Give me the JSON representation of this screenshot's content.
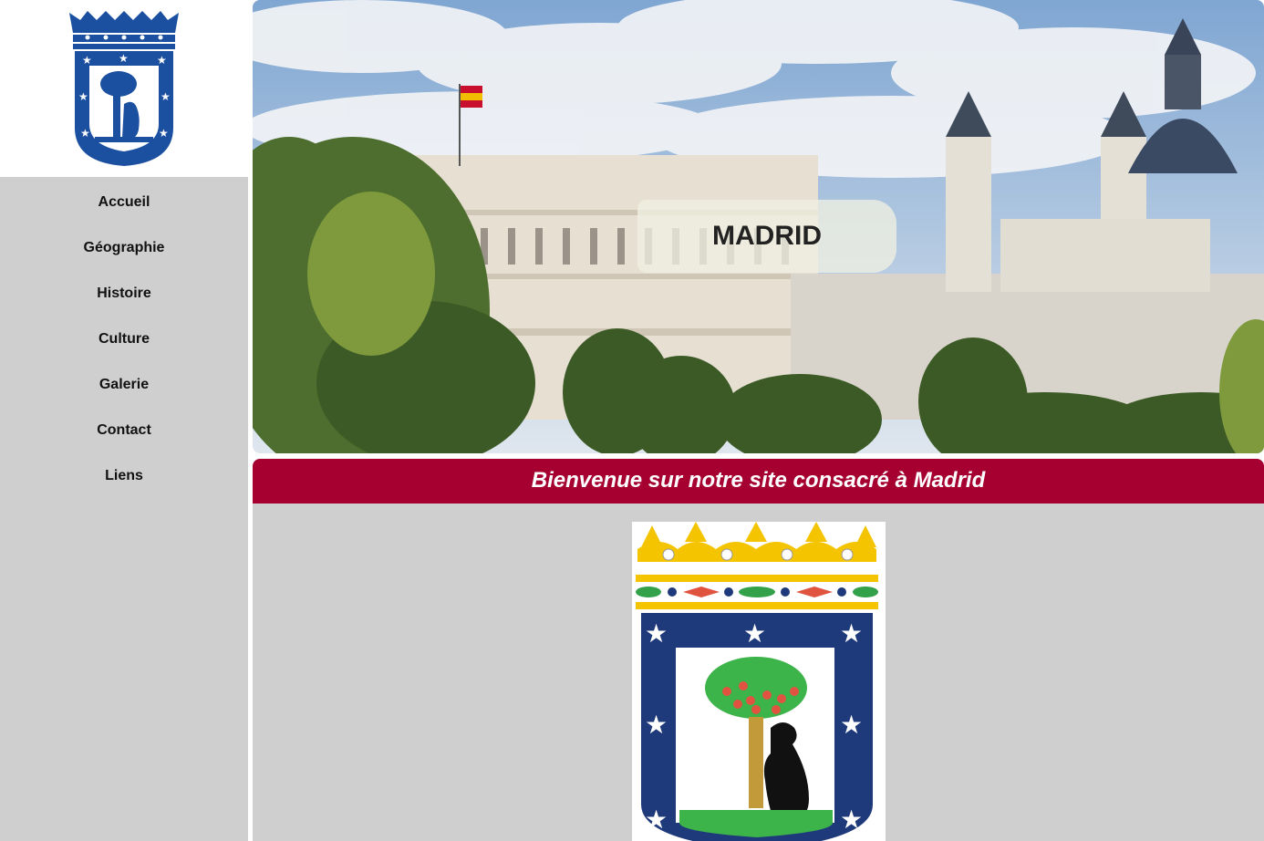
{
  "nav": {
    "items": [
      {
        "label": "Accueil"
      },
      {
        "label": "Géographie"
      },
      {
        "label": "Histoire"
      },
      {
        "label": "Culture"
      },
      {
        "label": "Galerie"
      },
      {
        "label": "Contact"
      },
      {
        "label": "Liens"
      }
    ]
  },
  "hero": {
    "title": "MADRID"
  },
  "welcome": {
    "text": "Bienvenue sur notre site consacré à Madrid"
  },
  "colors": {
    "accent": "#a60030",
    "sidebar_bg": "#cfcfcf",
    "coat_blue": "#1f3a7a",
    "crown_gold": "#f5c400"
  },
  "icons": {
    "logo": "madrid-coat-of-arms-icon",
    "emblem": "madrid-coat-of-arms-icon"
  }
}
